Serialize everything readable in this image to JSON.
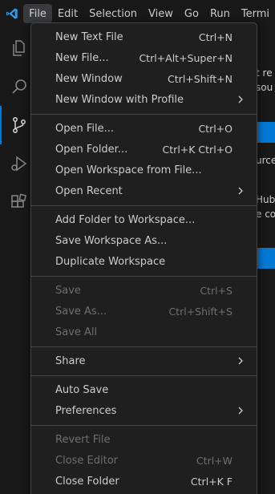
{
  "menubar": {
    "items": [
      "File",
      "Edit",
      "Selection",
      "View",
      "Go",
      "Run",
      "Termi"
    ]
  },
  "sidebar": {
    "fragments": [
      "t re",
      "sou",
      "urce",
      "Hub",
      "e co"
    ]
  },
  "file_menu": {
    "group1": [
      {
        "label": "New Text File",
        "shortcut": "Ctrl+N"
      },
      {
        "label": "New File...",
        "shortcut": "Ctrl+Alt+Super+N"
      },
      {
        "label": "New Window",
        "shortcut": "Ctrl+Shift+N"
      },
      {
        "label": "New Window with Profile",
        "submenu": true
      }
    ],
    "group2": [
      {
        "label": "Open File...",
        "shortcut": "Ctrl+O"
      },
      {
        "label": "Open Folder...",
        "shortcut": "Ctrl+K Ctrl+O"
      },
      {
        "label": "Open Workspace from File...",
        "shortcut": ""
      },
      {
        "label": "Open Recent",
        "submenu": true
      }
    ],
    "group3": [
      {
        "label": "Add Folder to Workspace...",
        "shortcut": ""
      },
      {
        "label": "Save Workspace As...",
        "shortcut": ""
      },
      {
        "label": "Duplicate Workspace",
        "shortcut": ""
      }
    ],
    "group4": [
      {
        "label": "Save",
        "shortcut": "Ctrl+S",
        "disabled": true
      },
      {
        "label": "Save As...",
        "shortcut": "Ctrl+Shift+S",
        "disabled": true
      },
      {
        "label": "Save All",
        "shortcut": "",
        "disabled": true
      }
    ],
    "group5": [
      {
        "label": "Share",
        "submenu": true
      }
    ],
    "group6": [
      {
        "label": "Auto Save",
        "shortcut": ""
      },
      {
        "label": "Preferences",
        "submenu": true
      }
    ],
    "group7": [
      {
        "label": "Revert File",
        "shortcut": "",
        "disabled": true
      },
      {
        "label": "Close Editor",
        "shortcut": "Ctrl+W",
        "disabled": true
      },
      {
        "label": "Close Folder",
        "shortcut": "Ctrl+K F"
      }
    ]
  },
  "colors": {
    "accent": "#0078d4",
    "menu_bg": "#1f1f1f",
    "border": "#454545"
  }
}
